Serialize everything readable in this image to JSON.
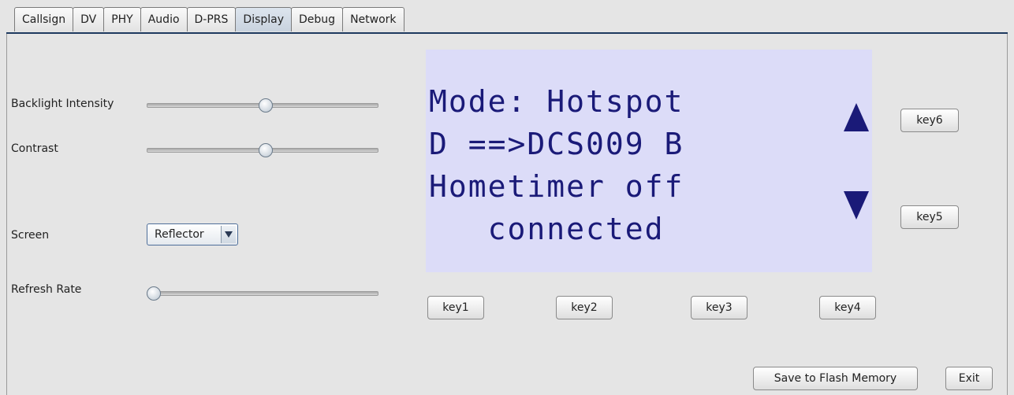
{
  "tabs": [
    "Callsign",
    "DV",
    "PHY",
    "Audio",
    "D-PRS",
    "Display",
    "Debug",
    "Network"
  ],
  "active_tab": "Display",
  "settings": {
    "backlight_label": "Backlight Intensity",
    "backlight_value": 0.51,
    "contrast_label": "Contrast",
    "contrast_value": 0.51,
    "screen_label": "Screen",
    "screen_value": "Reflector",
    "refresh_label": "Refresh Rate",
    "refresh_value": 0.0
  },
  "display": {
    "line1": "Mode: Hotspot",
    "line2": "D ==>DCS009 B",
    "line3": "Hometimer off",
    "line4": "   connected",
    "color": "#1a1a78",
    "background": "#dcdcf8",
    "up_icon": "triangle-up-icon",
    "down_icon": "triangle-down-icon"
  },
  "keys": {
    "key1": "key1",
    "key2": "key2",
    "key3": "key3",
    "key4": "key4",
    "key5": "key5",
    "key6": "key6"
  },
  "footer": {
    "save_label": "Save to Flash Memory",
    "exit_label": "Exit"
  }
}
